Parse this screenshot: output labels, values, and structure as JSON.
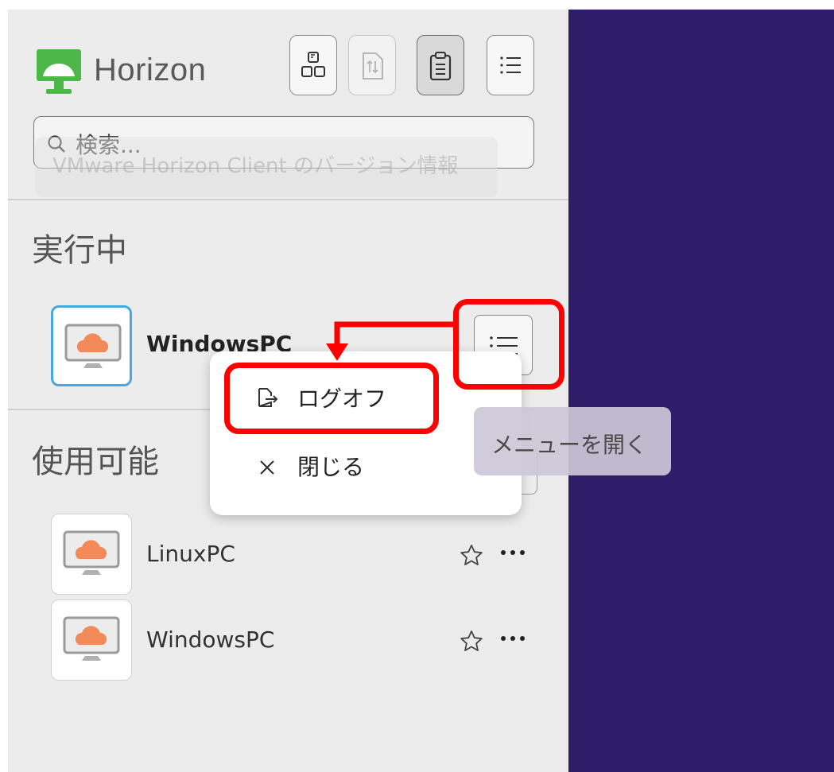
{
  "app": {
    "name": "Horizon",
    "logo_icon": "horizon-logo-icon",
    "brand_color": "#4cb648"
  },
  "toolbar": {
    "buttons": [
      {
        "icon": "grid-view-icon",
        "state": "normal"
      },
      {
        "icon": "sort-icon",
        "state": "disabled"
      },
      {
        "icon": "clipboard-icon",
        "state": "selected"
      },
      {
        "icon": "list-view-icon",
        "state": "normal"
      }
    ]
  },
  "search": {
    "placeholder": "検索...",
    "icon": "search-icon"
  },
  "faded_tooltip": {
    "text": "VMware Horizon Client のバージョン情報"
  },
  "running": {
    "heading": "実行中",
    "items": [
      {
        "name": "WindowsPC",
        "icon": "desktop-icon",
        "menu_icon": "menu-icon"
      }
    ]
  },
  "available": {
    "heading": "使用可能",
    "items": [
      {
        "name": "LinuxPC",
        "icon": "desktop-icon",
        "favorite_icon": "star-icon",
        "more_icon": "more-icon"
      },
      {
        "name": "WindowsPC",
        "icon": "desktop-icon",
        "favorite_icon": "star-icon",
        "more_icon": "more-icon"
      }
    ]
  },
  "context_menu": {
    "items": [
      {
        "label": "ログオフ",
        "icon": "logoff-icon"
      },
      {
        "label": "閉じる",
        "icon": "close-icon"
      }
    ]
  },
  "tooltip": {
    "text": "メニューを開く"
  },
  "colors": {
    "right_panel": "#2f1d69",
    "annotation": "#ff0000",
    "running_tile_border": "#49a7e0",
    "cloud": "#f28a5a"
  }
}
